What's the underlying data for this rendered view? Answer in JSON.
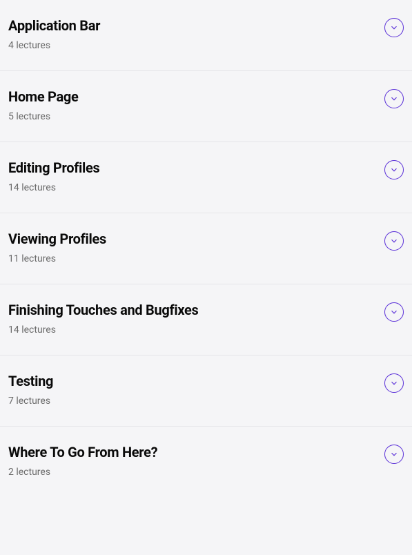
{
  "sections": [
    {
      "title": "Application Bar",
      "subtitle": "4 lectures"
    },
    {
      "title": "Home Page",
      "subtitle": "5 lectures"
    },
    {
      "title": "Editing Profiles",
      "subtitle": "14 lectures"
    },
    {
      "title": "Viewing Profiles",
      "subtitle": "11 lectures"
    },
    {
      "title": "Finishing Touches and Bugfixes",
      "subtitle": "14 lectures"
    },
    {
      "title": "Testing",
      "subtitle": "7 lectures"
    },
    {
      "title": "Where To Go From Here?",
      "subtitle": "2 lectures"
    }
  ],
  "colors": {
    "background": "#f5f5f7",
    "text_primary": "#0a0a0a",
    "text_secondary": "#6b6b6b",
    "accent": "#5a2fd8",
    "divider": "#e5e5e9"
  }
}
